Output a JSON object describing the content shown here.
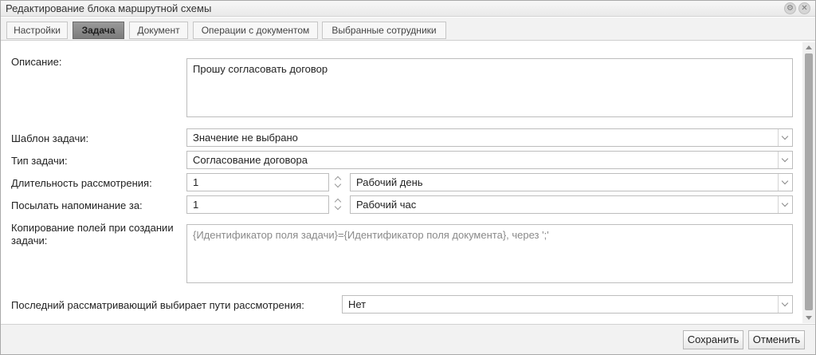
{
  "window": {
    "title": "Редактирование блока маршрутной схемы"
  },
  "tabs": [
    {
      "label": "Настройки",
      "active": false
    },
    {
      "label": "Задача",
      "active": true
    },
    {
      "label": "Документ",
      "active": false
    },
    {
      "label": "Операции с документом",
      "active": false
    },
    {
      "label": "Выбранные сотрудники",
      "active": false
    }
  ],
  "form": {
    "description": {
      "label": "Описание:",
      "value": "Прошу согласовать договор"
    },
    "task_template": {
      "label": "Шаблон задачи:",
      "value": "Значение не выбрано"
    },
    "task_type": {
      "label": "Тип задачи:",
      "value": "Согласование договора"
    },
    "review_duration": {
      "label": "Длительность рассмотрения:",
      "value": "1",
      "unit": "Рабочий день"
    },
    "reminder": {
      "label": "Посылать напоминание за:",
      "value": "1",
      "unit": "Рабочий час"
    },
    "field_copy": {
      "label": "Копирование полей при создании задачи:",
      "placeholder": "{Идентификатор поля задачи}={Идентификатор поля документа}, через ';'"
    },
    "last_reviewer_paths": {
      "label": "Последний рассматривающий выбирает пути рассмотрения:",
      "value": "Нет"
    }
  },
  "footer": {
    "save_label": "Сохранить",
    "cancel_label": "Отменить"
  }
}
